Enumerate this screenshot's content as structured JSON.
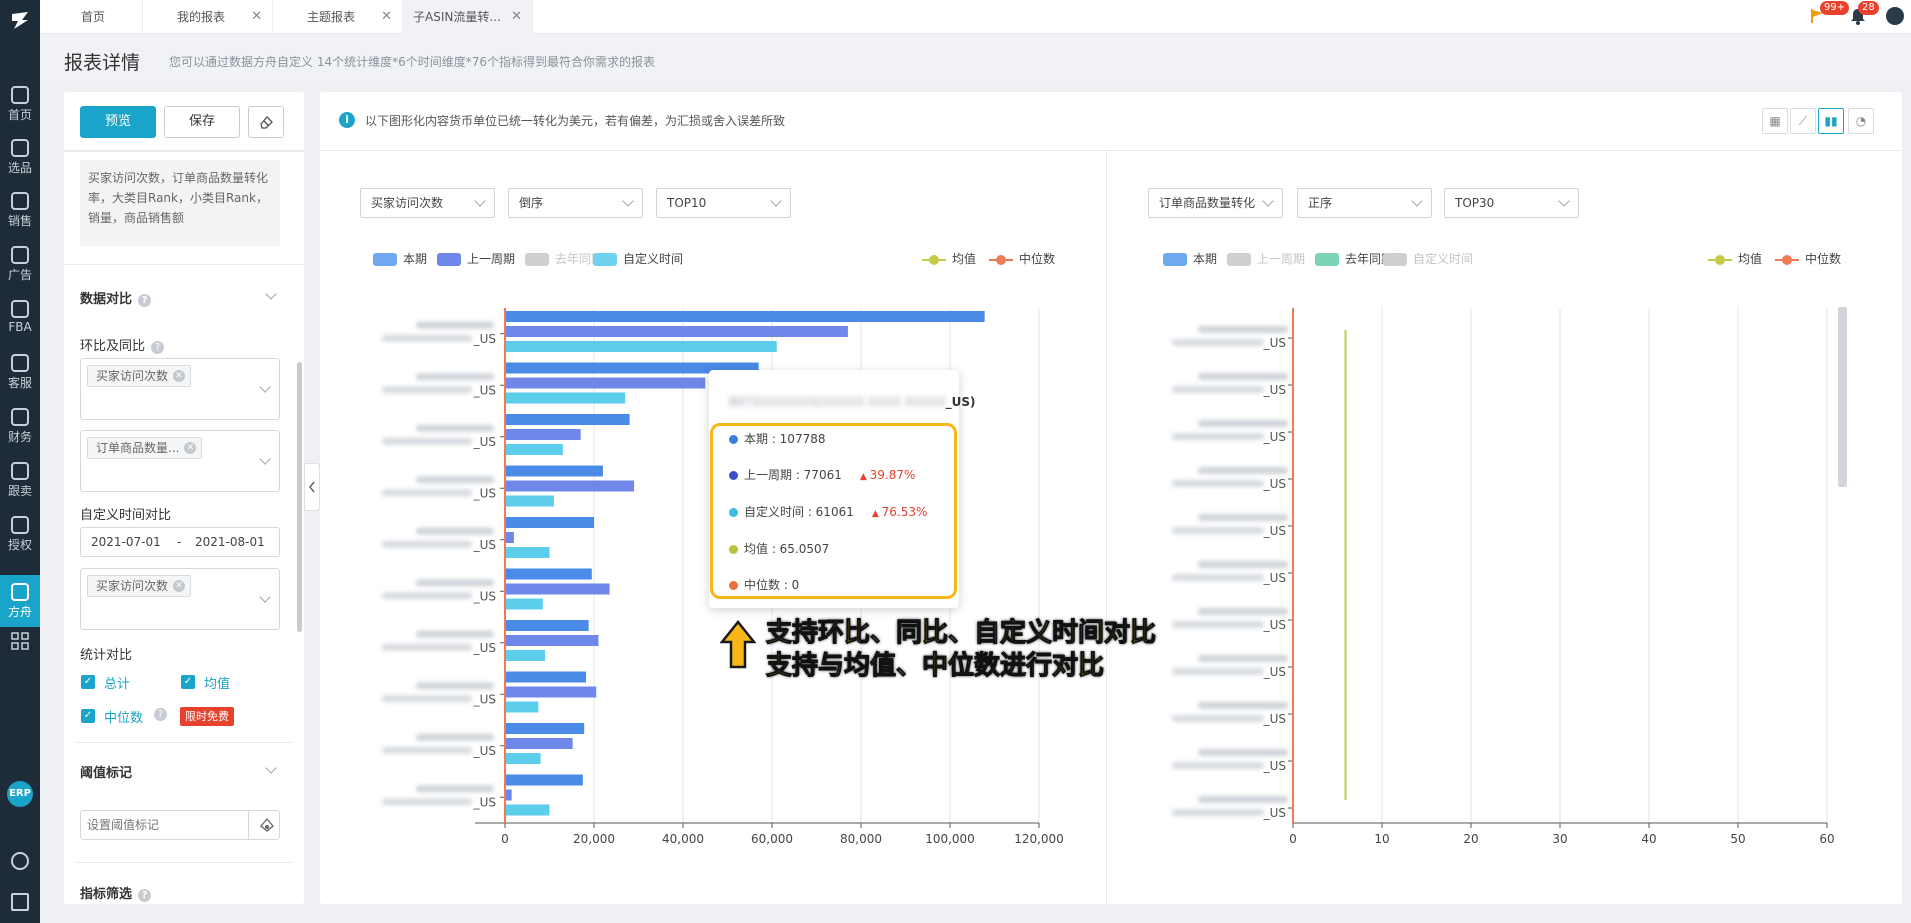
{
  "nav": {
    "items": [
      {
        "label": "首页",
        "icon": "home-icon"
      },
      {
        "label": "选品",
        "icon": "search-icon"
      },
      {
        "label": "销售",
        "icon": "trend-icon"
      },
      {
        "label": "广告",
        "icon": "ad-icon"
      },
      {
        "label": "FBA",
        "icon": "fba-icon"
      },
      {
        "label": "客服",
        "icon": "service-icon"
      },
      {
        "label": "财务",
        "icon": "finance-icon"
      },
      {
        "label": "跟卖",
        "icon": "follow-sell-icon"
      },
      {
        "label": "授权",
        "icon": "shield-icon"
      },
      {
        "label": "方舟",
        "icon": "ark-icon"
      }
    ],
    "erp_badge": "ERP"
  },
  "tabs": [
    {
      "label": "首页",
      "closable": false
    },
    {
      "label": "我的报表",
      "closable": true
    },
    {
      "label": "主题报表",
      "closable": true
    },
    {
      "label": "子ASIN流量转...",
      "closable": true
    }
  ],
  "topbar": {
    "flag_badge": "99+",
    "bell_badge": "28"
  },
  "page": {
    "title": "报表详情",
    "subtitle": "您可以通过数据方舟自定义 14个统计维度*6个时间维度*76个指标得到最符合你需求的报表"
  },
  "left": {
    "preview_label": "预览",
    "save_label": "保存",
    "metrics_text": "买家访问次数，订单商品数量转化率，大类目Rank，小类目Rank，销量，商品销售额",
    "compare_title": "数据对比",
    "mom_yoy_label": "环比及同比",
    "tag1": "买家访问次数",
    "tag2": "订单商品数量...",
    "custom_time_label": "自定义时间对比",
    "date_start": "2021-07-01",
    "date_sep": "-",
    "date_end": "2021-08-01",
    "tag3": "买家访问次数",
    "stat_label": "统计对比",
    "cb_total": "总计",
    "cb_mean": "均值",
    "cb_median": "中位数",
    "free_badge": "限时免费",
    "threshold_title": "阈值标记",
    "threshold_placeholder": "设置阈值标记",
    "filter_title": "指标筛选"
  },
  "main": {
    "info": "以下图形化内容货币单位已统一转化为美元，若有偏差，为汇损或舍入误差所致",
    "view_icons": [
      "table-view-icon",
      "line-view-icon",
      "bar-view-icon",
      "pie-view-icon"
    ]
  },
  "chart_left": {
    "metric_select": "买家访问次数",
    "order_select": "倒序",
    "top_select": "TOP10",
    "legend": [
      {
        "name": "本期",
        "color": "#6fa8f0",
        "muted": false
      },
      {
        "name": "上一周期",
        "color": "#6f87e8",
        "muted": false
      },
      {
        "name": "去年同期",
        "color": "#cfcfcf",
        "muted": true
      },
      {
        "name": "自定义时间",
        "color": "#6fd2ee",
        "muted": false
      }
    ],
    "legend_lines": [
      {
        "name": "均值",
        "color": "#c3cd4a"
      },
      {
        "name": "中位数",
        "color": "#ef7a56"
      }
    ],
    "row_suffix": "_US"
  },
  "chart_right": {
    "metric_select": "订单商品数量转化",
    "order_select": "正序",
    "top_select": "TOP30",
    "legend": [
      {
        "name": "本期",
        "color": "#6fa8f0",
        "muted": false
      },
      {
        "name": "上一周期",
        "color": "#cfcfcf",
        "muted": true
      },
      {
        "name": "去年同期",
        "color": "#7dd3b8",
        "muted": false
      },
      {
        "name": "自定义时间",
        "color": "#cfcfcf",
        "muted": true
      }
    ],
    "legend_lines": [
      {
        "name": "均值",
        "color": "#c3cd4a"
      },
      {
        "name": "中位数",
        "color": "#ef7a56"
      }
    ],
    "row_suffix": "_US"
  },
  "tooltip": {
    "title_suffix": "_US)",
    "rows": [
      {
        "label": "本期 : 107788",
        "color": "#3b7de0",
        "change": ""
      },
      {
        "label": "上一周期 : 77061",
        "color": "#3c50c9",
        "change": "39.87%"
      },
      {
        "label": "自定义时间 : 61061",
        "color": "#3cbfe0",
        "change": "76.53%"
      },
      {
        "label": "均值 : 65.0507",
        "color": "#b8c23a",
        "change": ""
      },
      {
        "label": "中位数 : 0",
        "color": "#e8703f",
        "change": ""
      }
    ]
  },
  "annotation": {
    "line1": "支持环比、同比、自定义时间对比",
    "line2": "支持与均值、中位数进行对比"
  },
  "chart_data": [
    {
      "type": "bar",
      "orientation": "horizontal",
      "xlim": [
        0,
        120000
      ],
      "xticks": [
        "0",
        "20,000",
        "40,000",
        "60,000",
        "80,000",
        "100,000",
        "120,000"
      ],
      "series": [
        {
          "name": "本期",
          "color": "#4a8be8",
          "values": [
            107788,
            57000,
            28000,
            22000,
            20000,
            19500,
            18800,
            18200,
            17800,
            17500
          ]
        },
        {
          "name": "上一周期",
          "color": "#6f87e8",
          "values": [
            77061,
            45000,
            17000,
            29000,
            2000,
            23500,
            21000,
            20500,
            15200,
            1500
          ]
        },
        {
          "name": "自定义时间",
          "color": "#5ccdeb",
          "values": [
            61061,
            27000,
            13000,
            11000,
            10000,
            8500,
            9000,
            7500,
            8000,
            10000
          ]
        }
      ],
      "highlight_series": [
        "本期",
        "上一周期",
        "自定义时间"
      ],
      "median": 0
    },
    {
      "type": "bar",
      "orientation": "horizontal",
      "xlim": [
        0,
        60
      ],
      "xticks": [
        "0",
        "10",
        "20",
        "30",
        "40",
        "50",
        "60"
      ],
      "rows": 11,
      "mean": 5.9,
      "median": 0
    }
  ]
}
